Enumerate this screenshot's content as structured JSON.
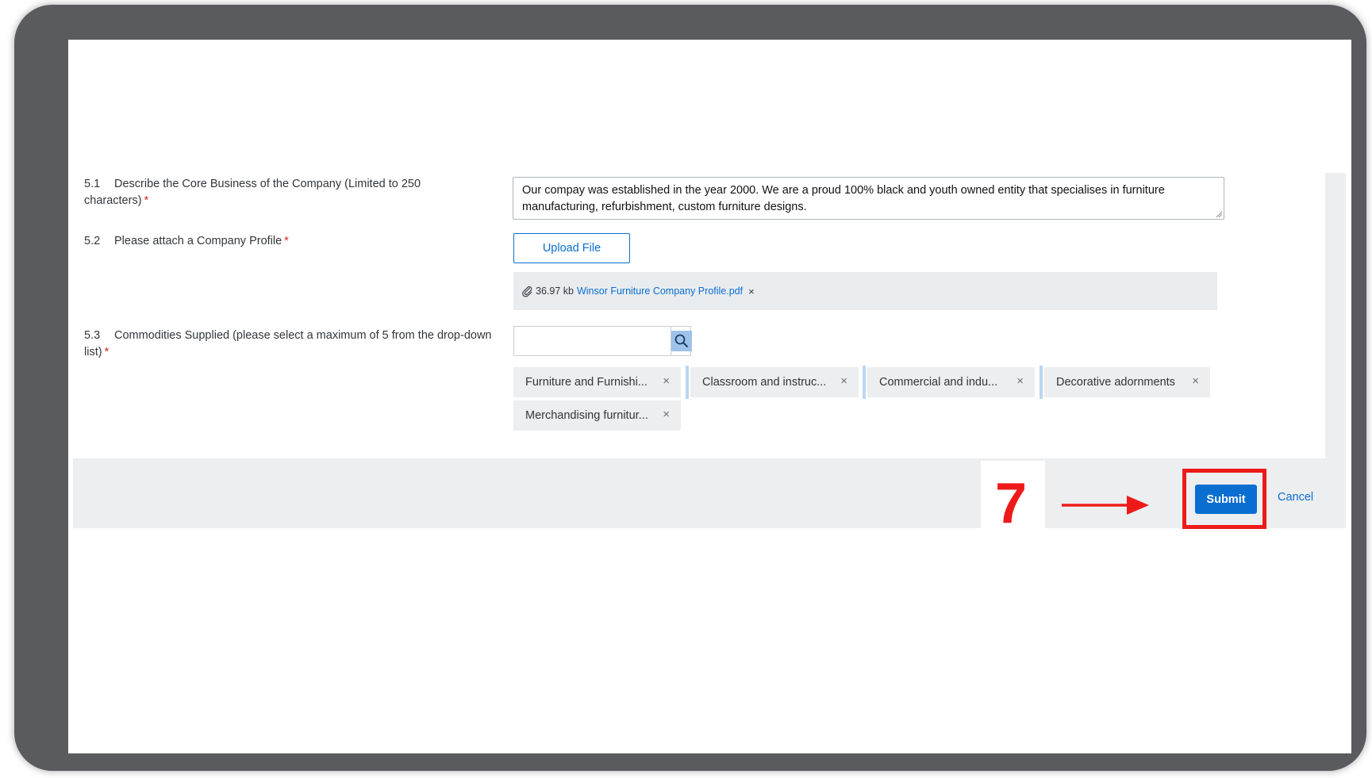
{
  "question_5_1": {
    "number": "5.1",
    "label": "Describe the Core Business of the Company (Limited to 250 characters)",
    "required_mark": "*",
    "value": "Our compay was established in the year 2000. We are a proud 100% black and youth owned entity that specialises in furniture manufacturing, refurbishment, custom furniture designs."
  },
  "question_5_2": {
    "number": "5.2",
    "label": "Please attach a Company Profile",
    "required_mark": "*",
    "upload_label": "Upload File",
    "attachment": {
      "icon": "paperclip-icon",
      "size": "36.97 kb",
      "filename": "Winsor Furniture Company Profile.pdf",
      "remove_icon": "×"
    }
  },
  "question_5_3": {
    "number": "5.3",
    "label": "Commodities Supplied (please select a maximum of 5 from the drop-down list)",
    "required_mark": "*",
    "search_value": "",
    "search_icon": "search-icon",
    "tokens": [
      {
        "label": "Furniture and Furnishi...",
        "remove": "×"
      },
      {
        "label": "Classroom and instruc...",
        "remove": "×"
      },
      {
        "label": "Commercial and indu...",
        "remove": "×"
      },
      {
        "label": "Decorative adornments",
        "remove": "×"
      },
      {
        "label": "Merchandising furnitur...",
        "remove": "×"
      }
    ]
  },
  "footer": {
    "step_number": "7",
    "submit_label": "Submit",
    "cancel_label": "Cancel"
  },
  "colors": {
    "accent": "#0a6ed1",
    "required": "#d0271d",
    "annotation": "#ee1a1a",
    "frame": "#5a5b5f"
  }
}
